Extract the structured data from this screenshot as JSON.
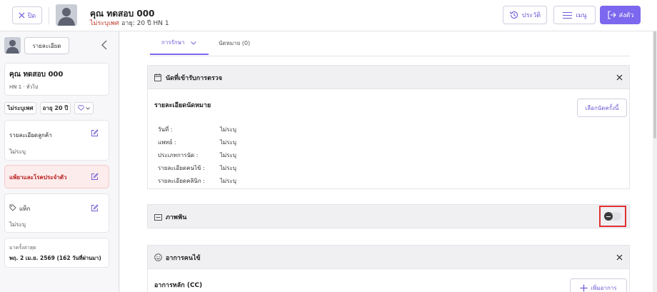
{
  "header": {
    "close_label": "ปิด",
    "patient_name": "คุณ ทดสอบ 000",
    "gender": "ไม่ระบุเพศ",
    "age_hn": "อายุ: 20 ปี  HN 1",
    "history_label": "ประวัติ",
    "menu_label": "เมนู",
    "send_label": "ส่งตัว"
  },
  "sidebar": {
    "details_button": "รายละเอียด",
    "name": "คุณ ทดสอบ 000",
    "hn_line": "HN 1 · ทั่วไป",
    "gender_chip": "ไม่ระบุเพศ",
    "age_chip": "อายุ 20 ปี",
    "customer_details_title": "รายละเอียดลูกค้า",
    "customer_details_value": "ไม่ระบุ",
    "allergy_title": "แพ้ยาและโรคประจำตัว",
    "tag_title": "แท็ก",
    "tag_value": "ไม่ระบุ",
    "last_visit_label": "มาครั้งล่าสุด",
    "last_visit_value": "พฤ. 2 เม.ย. 2569 (162 วันที่ผ่านมา)"
  },
  "tabs": {
    "treatment": "การรักษา",
    "appointment": "นัดหมาย (0)"
  },
  "appointment_section": {
    "title": "นัดที่เข้ารับการตรวจ",
    "details_title": "รายละเอียดนัดหมาย",
    "select_button": "เลือกนัดครั้งนี้",
    "rows": [
      {
        "label": "วันที่ :",
        "value": "ไม่ระบุ"
      },
      {
        "label": "แพทย์ :",
        "value": "ไม่ระบุ"
      },
      {
        "label": "ประเภทการนัด :",
        "value": "ไม่ระบุ"
      },
      {
        "label": "รายละเอียดคนไข้ :",
        "value": "ไม่ระบุ"
      },
      {
        "label": "รายละเอียดคลินิก :",
        "value": "ไม่ระบุ"
      }
    ]
  },
  "photo_section": {
    "title": "ภาพฟัน",
    "toggle_on": false
  },
  "symptom_section": {
    "title": "อาการคนไข้",
    "cc_title": "อาการหลัก (CC)",
    "add_button": "เพิ่มอาการ"
  },
  "colors": {
    "accent": "#7b68ee",
    "danger_text": "#c0392b",
    "highlight_border": "#e03131"
  }
}
